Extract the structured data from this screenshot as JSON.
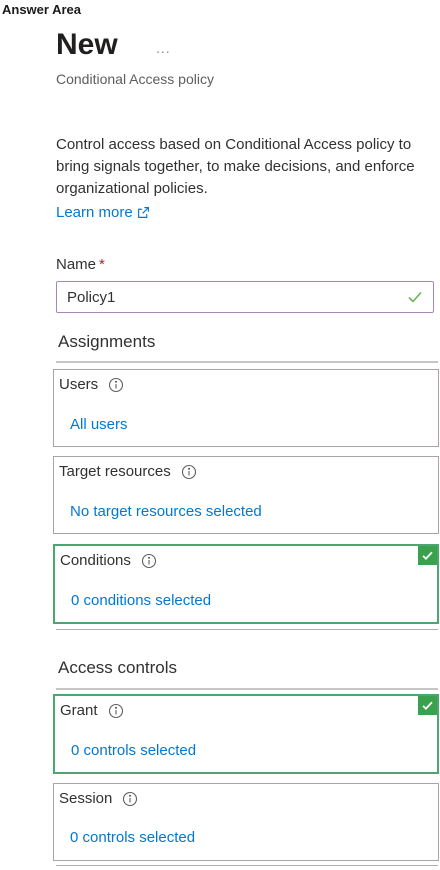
{
  "answer_area": "Answer Area",
  "header": {
    "title": "New",
    "more": "...",
    "subtitle": "Conditional Access policy"
  },
  "description": "Control access based on Conditional Access policy to bring signals together, to make decisions, and enforce organizational policies.",
  "learn_more": "Learn more",
  "name_field": {
    "label": "Name",
    "required_marker": "*",
    "value": "Policy1"
  },
  "assignments": {
    "title": "Assignments",
    "users": {
      "label": "Users",
      "value": "All users"
    },
    "target_resources": {
      "label": "Target resources",
      "value": "No target resources selected"
    },
    "conditions": {
      "label": "Conditions",
      "value": "0 conditions selected"
    }
  },
  "access_controls": {
    "title": "Access controls",
    "grant": {
      "label": "Grant",
      "value": "0 controls selected"
    },
    "session": {
      "label": "Session",
      "value": "0 controls selected"
    }
  },
  "colors": {
    "link": "#0078d4",
    "valid_green": "#3aa14f",
    "required_red": "#a4262c"
  }
}
